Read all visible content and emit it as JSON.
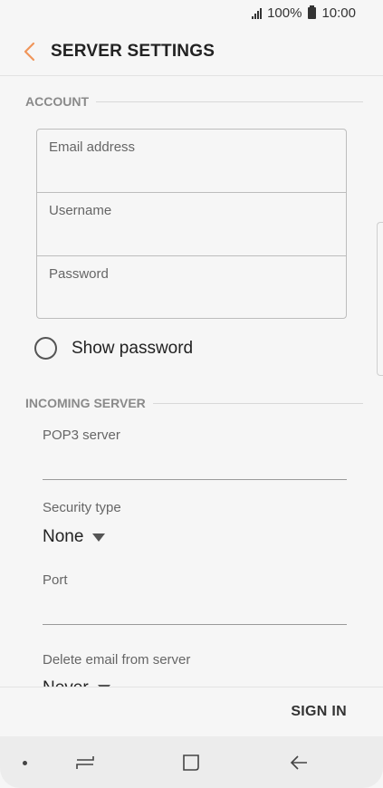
{
  "status_bar": {
    "battery": "100%",
    "time": "10:00"
  },
  "header": {
    "title": "SERVER SETTINGS"
  },
  "account": {
    "section_title": "ACCOUNT",
    "email_placeholder": "Email address",
    "username_placeholder": "Username",
    "password_placeholder": "Password",
    "show_password_label": "Show password"
  },
  "incoming": {
    "section_title": "INCOMING SERVER",
    "pop3_label": "POP3 server",
    "security_label": "Security type",
    "security_value": "None",
    "port_label": "Port",
    "delete_label": "Delete email from server",
    "delete_value": "Never"
  },
  "footer": {
    "sign_in": "SIGN IN"
  },
  "colors": {
    "accent": "#f0955a",
    "background": "#f6f6f6",
    "nav_bar": "#ececec"
  },
  "icons": [
    "signal-icon",
    "battery-icon",
    "back-arrow-icon",
    "recent-apps-icon",
    "home-icon",
    "back-icon"
  ]
}
